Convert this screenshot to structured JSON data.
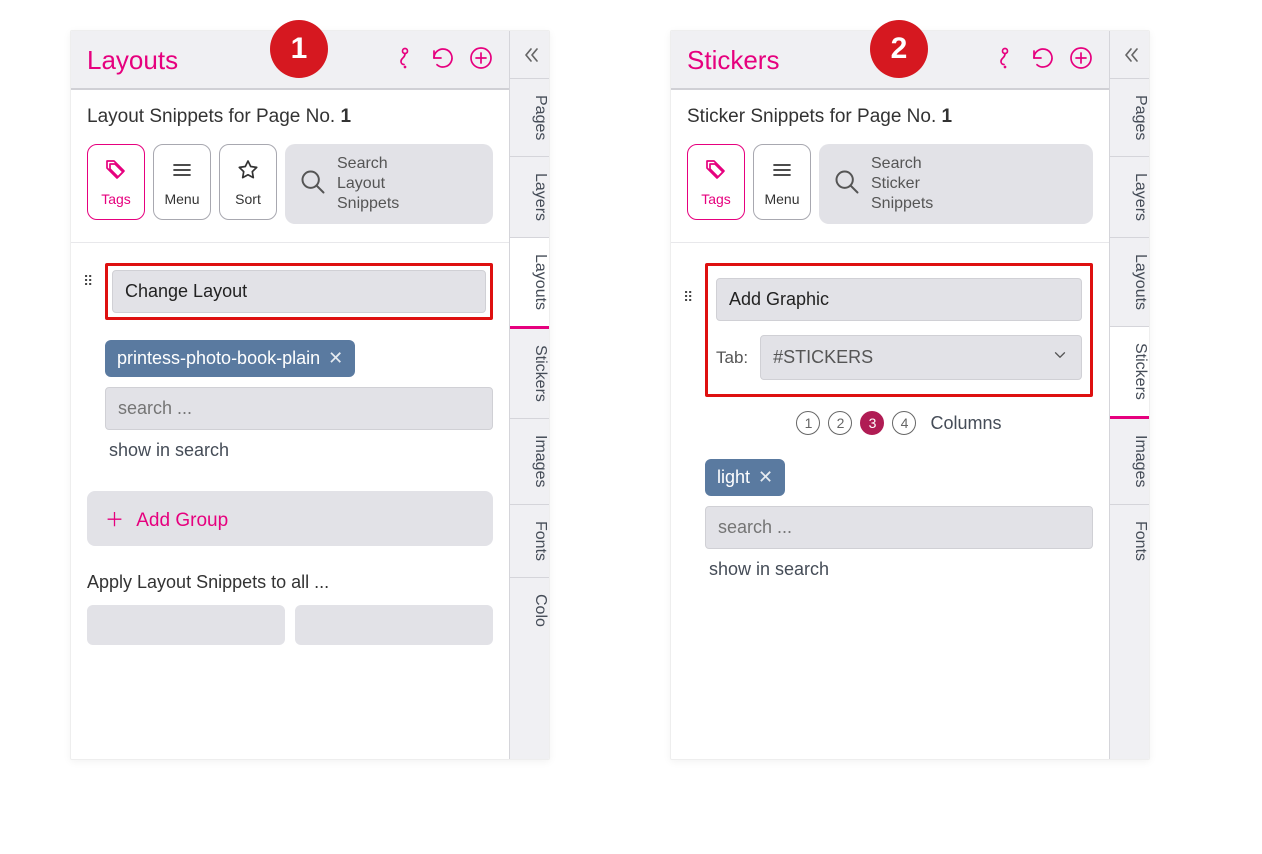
{
  "shot1": {
    "badge": "1",
    "title": "Layouts",
    "subtitle_prefix": "Layout Snippets for Page No. ",
    "subtitle_page": "1",
    "toolbar": {
      "tags": "Tags",
      "menu": "Menu",
      "sort": "Sort",
      "search_lines": "Search\nLayout\nSnippets"
    },
    "group": {
      "name": "Change Layout",
      "chip": "printess-photo-book-plain",
      "search_ph": "search ...",
      "show": "show in search"
    },
    "add_group": "Add Group",
    "apply": "Apply Layout Snippets to all ...",
    "tabs": [
      "Pages",
      "Layers",
      "Layouts",
      "Stickers",
      "Images",
      "Fonts",
      "Colo"
    ]
  },
  "shot2": {
    "badge": "2",
    "title": "Stickers",
    "subtitle_prefix": "Sticker Snippets for Page No. ",
    "subtitle_page": "1",
    "toolbar": {
      "tags": "Tags",
      "menu": "Menu",
      "search_lines": "Search\nSticker\nSnippets"
    },
    "group": {
      "name": "Add Graphic",
      "tab_label": "Tab:",
      "tab_value": "#STICKERS",
      "columns_label": "Columns",
      "columns_selected": 3,
      "chip": "light",
      "search_ph": "search ...",
      "show": "show in search"
    },
    "tabs": [
      "Pages",
      "Layers",
      "Layouts",
      "Stickers",
      "Images",
      "Fonts"
    ]
  }
}
